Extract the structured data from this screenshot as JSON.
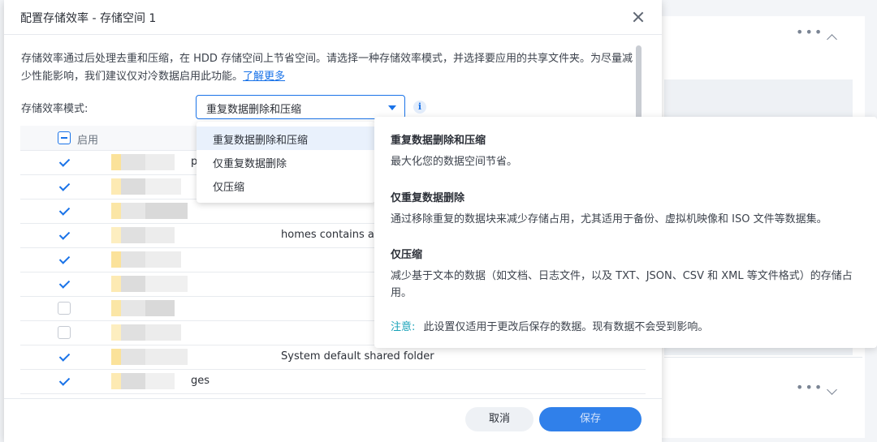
{
  "dialog": {
    "title": "配置存储效率 - 存储空间 1",
    "description": "存储效率通过后处理去重和压缩，在 HDD 存储空间上节省空间。请选择一种存储效率模式，并选择要应用的共享文件夹。为尽量减少性能影响，我们建议仅对冷数据启用此功能。",
    "learn_more": "了解更多",
    "mode_label": "存储效率模式:",
    "mode_selected": "重复数据删除和压缩"
  },
  "dropdown": {
    "options": [
      "重复数据删除和压缩",
      "仅重复数据删除",
      "仅压缩"
    ]
  },
  "table": {
    "header_label": "启用",
    "rows": [
      {
        "checked": true,
        "suffix": "p",
        "desc": ""
      },
      {
        "checked": true,
        "suffix": "",
        "desc": ""
      },
      {
        "checked": true,
        "suffix": "",
        "desc": ""
      },
      {
        "checked": true,
        "suffix": "",
        "desc": "homes contains a"
      },
      {
        "checked": true,
        "suffix": "",
        "desc": ""
      },
      {
        "checked": true,
        "suffix": "",
        "desc": ""
      },
      {
        "checked": false,
        "suffix": "",
        "desc": ""
      },
      {
        "checked": false,
        "suffix": "",
        "desc": ""
      },
      {
        "checked": true,
        "suffix": "",
        "desc": "System default shared folder"
      },
      {
        "checked": true,
        "suffix": "ges",
        "desc": ""
      }
    ]
  },
  "tooltip": {
    "s1_title": "重复数据删除和压缩",
    "s1_body": "最大化您的数据空间节省。",
    "s2_title": "仅重复数据删除",
    "s2_body": "通过移除重复的数据块来减少存储占用，尤其适用于备份、虚拟机映像和 ISO 文件等数据集。",
    "s3_title": "仅压缩",
    "s3_body": "减少基于文本的数据（如文档、日志文件，以及 TXT、JSON、CSV 和 XML 等文件格式）的存储占用。",
    "note_label": "注意:",
    "note_body": "此设置仅适用于更改后保存的数据。现有数据不会受到影响。"
  },
  "footer": {
    "cancel": "取消",
    "save": "保存"
  },
  "icons": {
    "close": "close-icon",
    "info": "info-icon",
    "caret": "caret-down-icon",
    "more": "more-horizontal-icon"
  },
  "colors": {
    "accent": "#1a73e8",
    "note": "#17a2b8"
  }
}
